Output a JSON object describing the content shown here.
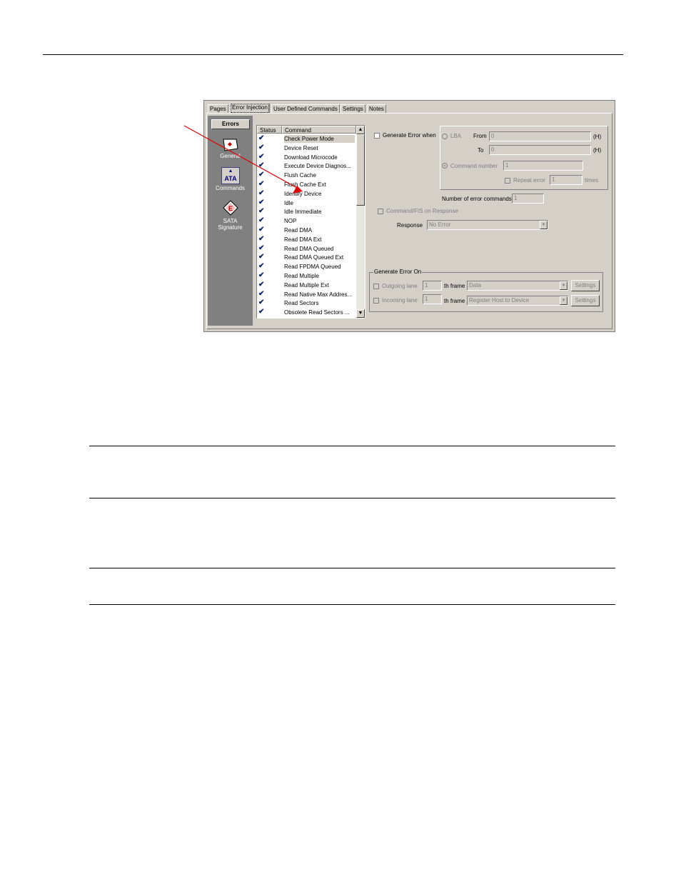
{
  "window": {
    "tabs": [
      {
        "label": "Pages"
      },
      {
        "label": "Error Injection"
      },
      {
        "label": "User Defined Commands"
      },
      {
        "label": "Settings"
      },
      {
        "label": "Notes"
      }
    ],
    "active_tab": "Error Injection"
  },
  "sidebar": {
    "header": "Errors",
    "items": [
      {
        "label": "General",
        "icon": "general-icon"
      },
      {
        "label": "Commands",
        "icon": "ata-icon",
        "icon_text": "ATA"
      },
      {
        "label_line1": "SATA",
        "label_line2": "Signature",
        "icon": "sata-signature-icon",
        "icon_text": "E"
      }
    ]
  },
  "command_list": {
    "columns": [
      "Status",
      "Command"
    ],
    "rows": [
      {
        "status": "✔",
        "command": "Check Power Mode",
        "selected": true
      },
      {
        "status": "✔",
        "command": "Device Reset"
      },
      {
        "status": "✔",
        "command": "Download Microcode"
      },
      {
        "status": "✔",
        "command": "Execute Device Diagnos..."
      },
      {
        "status": "✔",
        "command": "Flush Cache"
      },
      {
        "status": "✔",
        "command": "Flush Cache Ext"
      },
      {
        "status": "✔",
        "command": "Identify Device"
      },
      {
        "status": "✔",
        "command": "Idle"
      },
      {
        "status": "✔",
        "command": "Idle Immediate"
      },
      {
        "status": "✔",
        "command": "NOP"
      },
      {
        "status": "✔",
        "command": "Read DMA"
      },
      {
        "status": "✔",
        "command": "Read DMA Ext"
      },
      {
        "status": "✔",
        "command": "Read DMA Queued"
      },
      {
        "status": "✔",
        "command": "Read DMA Queued Ext"
      },
      {
        "status": "✔",
        "command": "Read FPDMA Queued"
      },
      {
        "status": "✔",
        "command": "Read Multiple"
      },
      {
        "status": "✔",
        "command": "Read Multiple Ext"
      },
      {
        "status": "✔",
        "command": "Read Native Max Addres..."
      },
      {
        "status": "✔",
        "command": "Read Sectors"
      },
      {
        "status": "✔",
        "command": "Obsolete Read Sectors ..."
      }
    ]
  },
  "generate_error_when": {
    "label": "Generate Error when",
    "lba_label": "LBA",
    "from_label": "From",
    "from_value": "0",
    "to_label": "To",
    "to_value": "0",
    "hex_suffix": "(H)",
    "command_number_label": "Command number",
    "command_number_value": "1",
    "repeat_error_label": "Repeat error",
    "repeat_error_value": "1",
    "times_label": "times",
    "num_error_commands_label": "Number of error commands",
    "num_error_commands_value": "1",
    "command_fis_label": "Command/FIS on Response",
    "response_label": "Response",
    "response_value": "No Error"
  },
  "generate_error_on": {
    "title": "Generate Error On",
    "outgoing_label": "Outgoing lane",
    "outgoing_value": "1",
    "outgoing_frame_label": "th frame",
    "outgoing_frame_value": "Data",
    "incoming_label": "Incoming lane",
    "incoming_value": "1",
    "incoming_frame_label": "th frame",
    "incoming_frame_value": "Register Host to Device",
    "settings_label": "Settings"
  },
  "colors": {
    "window_bg": "#d4d0c8",
    "sidebar_bg": "#808080",
    "annotation_arrow": "#e00000"
  }
}
